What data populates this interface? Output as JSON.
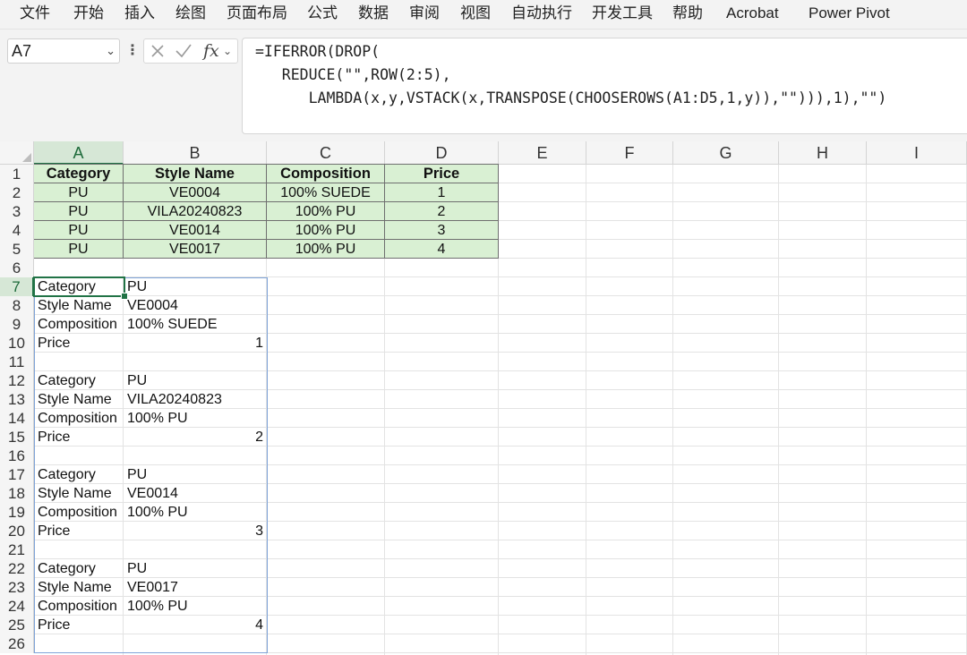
{
  "menu": {
    "items": [
      "文件",
      "开始",
      "插入",
      "绘图",
      "页面布局",
      "公式",
      "数据",
      "审阅",
      "视图",
      "自动执行",
      "开发工具",
      "帮助",
      "Acrobat",
      "Power Pivot"
    ]
  },
  "formula_bar": {
    "name_box": "A7",
    "fx_label": "fx",
    "lines": [
      "=IFERROR(DROP(",
      "   REDUCE(\"\",ROW(2:5),",
      "      LAMBDA(x,y,VSTACK(x,TRANSPOSE(CHOOSEROWS(A1:D5,1,y)),\"\"))),1),\"\")"
    ]
  },
  "sheet": {
    "columns": [
      "A",
      "B",
      "C",
      "D",
      "E",
      "F",
      "G",
      "H",
      "I"
    ],
    "selected_column": "A",
    "selected_row": 7,
    "rows": [
      "1",
      "2",
      "3",
      "4",
      "5",
      "6",
      "7",
      "8",
      "9",
      "10",
      "11",
      "12",
      "13",
      "14",
      "15",
      "16",
      "17",
      "18",
      "19",
      "20",
      "21",
      "22",
      "23",
      "24",
      "25",
      "26"
    ],
    "source_table": {
      "headers": [
        "Category",
        "Style Name",
        "Composition",
        "Price"
      ],
      "rows": [
        [
          "PU",
          "VE0004",
          "100% SUEDE",
          "1"
        ],
        [
          "PU",
          "VILA20240823",
          "100% PU",
          "2"
        ],
        [
          "PU",
          "VE0014",
          "100% PU",
          "3"
        ],
        [
          "PU",
          "VE0017",
          "100% PU",
          "4"
        ]
      ]
    },
    "spill_records": [
      {
        "labels": [
          "Category",
          "Style Name",
          "Composition",
          "Price"
        ],
        "values": [
          "PU",
          "VE0004",
          "100% SUEDE",
          "1"
        ]
      },
      {
        "labels": [
          "Category",
          "Style Name",
          "Composition",
          "Price"
        ],
        "values": [
          "PU",
          "VILA20240823",
          "100% PU",
          "2"
        ]
      },
      {
        "labels": [
          "Category",
          "Style Name",
          "Composition",
          "Price"
        ],
        "values": [
          "PU",
          "VE0014",
          "100% PU",
          "3"
        ]
      },
      {
        "labels": [
          "Category",
          "Style Name",
          "Composition",
          "Price"
        ],
        "values": [
          "PU",
          "VE0017",
          "100% PU",
          "4"
        ]
      }
    ]
  },
  "colors": {
    "table_fill": "#d9f0d3",
    "selection_green": "#217346",
    "spill_border": "#7fa3d8"
  }
}
